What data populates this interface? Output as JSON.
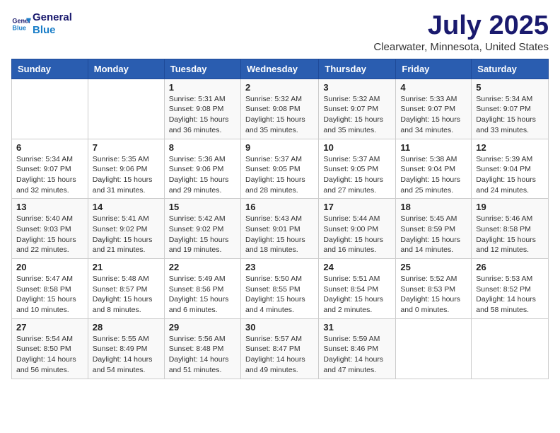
{
  "logo": {
    "line1": "General",
    "line2": "Blue"
  },
  "title": "July 2025",
  "subtitle": "Clearwater, Minnesota, United States",
  "weekdays": [
    "Sunday",
    "Monday",
    "Tuesday",
    "Wednesday",
    "Thursday",
    "Friday",
    "Saturday"
  ],
  "weeks": [
    [
      {
        "day": "",
        "sunrise": "",
        "sunset": "",
        "daylight": ""
      },
      {
        "day": "",
        "sunrise": "",
        "sunset": "",
        "daylight": ""
      },
      {
        "day": "1",
        "sunrise": "Sunrise: 5:31 AM",
        "sunset": "Sunset: 9:08 PM",
        "daylight": "Daylight: 15 hours and 36 minutes."
      },
      {
        "day": "2",
        "sunrise": "Sunrise: 5:32 AM",
        "sunset": "Sunset: 9:08 PM",
        "daylight": "Daylight: 15 hours and 35 minutes."
      },
      {
        "day": "3",
        "sunrise": "Sunrise: 5:32 AM",
        "sunset": "Sunset: 9:07 PM",
        "daylight": "Daylight: 15 hours and 35 minutes."
      },
      {
        "day": "4",
        "sunrise": "Sunrise: 5:33 AM",
        "sunset": "Sunset: 9:07 PM",
        "daylight": "Daylight: 15 hours and 34 minutes."
      },
      {
        "day": "5",
        "sunrise": "Sunrise: 5:34 AM",
        "sunset": "Sunset: 9:07 PM",
        "daylight": "Daylight: 15 hours and 33 minutes."
      }
    ],
    [
      {
        "day": "6",
        "sunrise": "Sunrise: 5:34 AM",
        "sunset": "Sunset: 9:07 PM",
        "daylight": "Daylight: 15 hours and 32 minutes."
      },
      {
        "day": "7",
        "sunrise": "Sunrise: 5:35 AM",
        "sunset": "Sunset: 9:06 PM",
        "daylight": "Daylight: 15 hours and 31 minutes."
      },
      {
        "day": "8",
        "sunrise": "Sunrise: 5:36 AM",
        "sunset": "Sunset: 9:06 PM",
        "daylight": "Daylight: 15 hours and 29 minutes."
      },
      {
        "day": "9",
        "sunrise": "Sunrise: 5:37 AM",
        "sunset": "Sunset: 9:05 PM",
        "daylight": "Daylight: 15 hours and 28 minutes."
      },
      {
        "day": "10",
        "sunrise": "Sunrise: 5:37 AM",
        "sunset": "Sunset: 9:05 PM",
        "daylight": "Daylight: 15 hours and 27 minutes."
      },
      {
        "day": "11",
        "sunrise": "Sunrise: 5:38 AM",
        "sunset": "Sunset: 9:04 PM",
        "daylight": "Daylight: 15 hours and 25 minutes."
      },
      {
        "day": "12",
        "sunrise": "Sunrise: 5:39 AM",
        "sunset": "Sunset: 9:04 PM",
        "daylight": "Daylight: 15 hours and 24 minutes."
      }
    ],
    [
      {
        "day": "13",
        "sunrise": "Sunrise: 5:40 AM",
        "sunset": "Sunset: 9:03 PM",
        "daylight": "Daylight: 15 hours and 22 minutes."
      },
      {
        "day": "14",
        "sunrise": "Sunrise: 5:41 AM",
        "sunset": "Sunset: 9:02 PM",
        "daylight": "Daylight: 15 hours and 21 minutes."
      },
      {
        "day": "15",
        "sunrise": "Sunrise: 5:42 AM",
        "sunset": "Sunset: 9:02 PM",
        "daylight": "Daylight: 15 hours and 19 minutes."
      },
      {
        "day": "16",
        "sunrise": "Sunrise: 5:43 AM",
        "sunset": "Sunset: 9:01 PM",
        "daylight": "Daylight: 15 hours and 18 minutes."
      },
      {
        "day": "17",
        "sunrise": "Sunrise: 5:44 AM",
        "sunset": "Sunset: 9:00 PM",
        "daylight": "Daylight: 15 hours and 16 minutes."
      },
      {
        "day": "18",
        "sunrise": "Sunrise: 5:45 AM",
        "sunset": "Sunset: 8:59 PM",
        "daylight": "Daylight: 15 hours and 14 minutes."
      },
      {
        "day": "19",
        "sunrise": "Sunrise: 5:46 AM",
        "sunset": "Sunset: 8:58 PM",
        "daylight": "Daylight: 15 hours and 12 minutes."
      }
    ],
    [
      {
        "day": "20",
        "sunrise": "Sunrise: 5:47 AM",
        "sunset": "Sunset: 8:58 PM",
        "daylight": "Daylight: 15 hours and 10 minutes."
      },
      {
        "day": "21",
        "sunrise": "Sunrise: 5:48 AM",
        "sunset": "Sunset: 8:57 PM",
        "daylight": "Daylight: 15 hours and 8 minutes."
      },
      {
        "day": "22",
        "sunrise": "Sunrise: 5:49 AM",
        "sunset": "Sunset: 8:56 PM",
        "daylight": "Daylight: 15 hours and 6 minutes."
      },
      {
        "day": "23",
        "sunrise": "Sunrise: 5:50 AM",
        "sunset": "Sunset: 8:55 PM",
        "daylight": "Daylight: 15 hours and 4 minutes."
      },
      {
        "day": "24",
        "sunrise": "Sunrise: 5:51 AM",
        "sunset": "Sunset: 8:54 PM",
        "daylight": "Daylight: 15 hours and 2 minutes."
      },
      {
        "day": "25",
        "sunrise": "Sunrise: 5:52 AM",
        "sunset": "Sunset: 8:53 PM",
        "daylight": "Daylight: 15 hours and 0 minutes."
      },
      {
        "day": "26",
        "sunrise": "Sunrise: 5:53 AM",
        "sunset": "Sunset: 8:52 PM",
        "daylight": "Daylight: 14 hours and 58 minutes."
      }
    ],
    [
      {
        "day": "27",
        "sunrise": "Sunrise: 5:54 AM",
        "sunset": "Sunset: 8:50 PM",
        "daylight": "Daylight: 14 hours and 56 minutes."
      },
      {
        "day": "28",
        "sunrise": "Sunrise: 5:55 AM",
        "sunset": "Sunset: 8:49 PM",
        "daylight": "Daylight: 14 hours and 54 minutes."
      },
      {
        "day": "29",
        "sunrise": "Sunrise: 5:56 AM",
        "sunset": "Sunset: 8:48 PM",
        "daylight": "Daylight: 14 hours and 51 minutes."
      },
      {
        "day": "30",
        "sunrise": "Sunrise: 5:57 AM",
        "sunset": "Sunset: 8:47 PM",
        "daylight": "Daylight: 14 hours and 49 minutes."
      },
      {
        "day": "31",
        "sunrise": "Sunrise: 5:59 AM",
        "sunset": "Sunset: 8:46 PM",
        "daylight": "Daylight: 14 hours and 47 minutes."
      },
      {
        "day": "",
        "sunrise": "",
        "sunset": "",
        "daylight": ""
      },
      {
        "day": "",
        "sunrise": "",
        "sunset": "",
        "daylight": ""
      }
    ]
  ]
}
